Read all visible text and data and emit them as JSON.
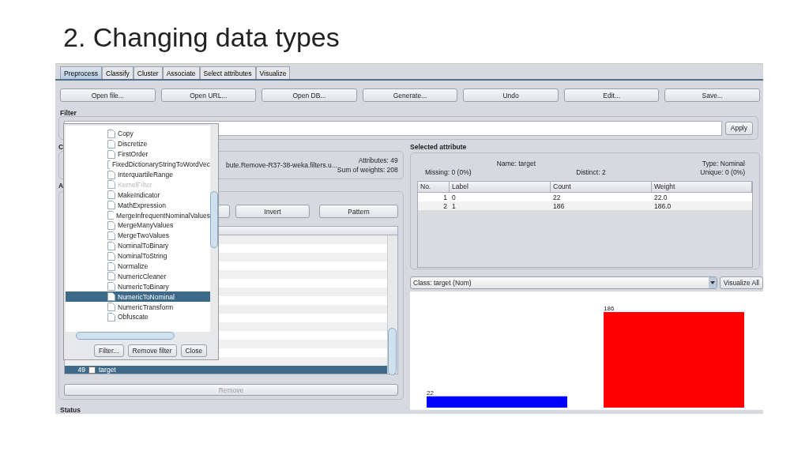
{
  "slide_title": "2. Changing data types",
  "tabs": [
    {
      "label": "Preprocess",
      "selected": true
    },
    {
      "label": "Classify",
      "selected": false
    },
    {
      "label": "Cluster",
      "selected": false
    },
    {
      "label": "Associate",
      "selected": false
    },
    {
      "label": "Select attributes",
      "selected": false
    },
    {
      "label": "Visualize",
      "selected": false
    }
  ],
  "toolbar": [
    "Open file...",
    "Open URL...",
    "Open DB...",
    "Generate...",
    "Undo",
    "Edit...",
    "Save..."
  ],
  "filter": {
    "label": "Filter",
    "apply": "Apply"
  },
  "current_relation": {
    "label": "C",
    "relation": "bute.Remove-R37-38-weka.filters.u...",
    "attributes": "Attributes: 49",
    "weights": "Sum of weights: 208"
  },
  "attributes": {
    "label": "A",
    "buttons": [
      "Invert",
      "Pattern"
    ],
    "rows": [
      {
        "no": "49",
        "name": "target",
        "checked": false,
        "selected": true
      }
    ],
    "remove": "Remove",
    "remove_disabled": true
  },
  "status_label": "Status",
  "selected_attribute": {
    "label": "Selected attribute",
    "name": "Name: target",
    "type": "Type: Nominal",
    "missing": "Missing: 0 (0%)",
    "distinct": "Distinct: 2",
    "unique": "Unique: 0 (0%)",
    "columns": [
      "No.",
      "Label",
      "Count",
      "Weight"
    ],
    "rows": [
      [
        "1",
        "0",
        "22",
        "22.0"
      ],
      [
        "2",
        "1",
        "186",
        "186.0"
      ]
    ]
  },
  "class_select": "Class: target (Nom)",
  "visualize_all": "Visualize All",
  "chart_data": {
    "type": "bar",
    "values": [
      22,
      186
    ],
    "colors": [
      "#0000ff",
      "#ff0000"
    ],
    "data_labels": true
  },
  "filter_popup": {
    "items": [
      {
        "label": "Copy",
        "disabled": false,
        "selected": false
      },
      {
        "label": "Discretize",
        "disabled": false,
        "selected": false
      },
      {
        "label": "FirstOrder",
        "disabled": false,
        "selected": false
      },
      {
        "label": "FixedDictionaryStringToWordVec",
        "disabled": false,
        "selected": false
      },
      {
        "label": "InterquartileRange",
        "disabled": false,
        "selected": false
      },
      {
        "label": "KernelFilter",
        "disabled": true,
        "selected": false
      },
      {
        "label": "MakeIndicator",
        "disabled": false,
        "selected": false
      },
      {
        "label": "MathExpression",
        "disabled": false,
        "selected": false
      },
      {
        "label": "MergeInfrequentNominalValues",
        "disabled": false,
        "selected": false
      },
      {
        "label": "MergeManyValues",
        "disabled": false,
        "selected": false
      },
      {
        "label": "MergeTwoValues",
        "disabled": false,
        "selected": false
      },
      {
        "label": "NominalToBinary",
        "disabled": false,
        "selected": false
      },
      {
        "label": "NominalToString",
        "disabled": false,
        "selected": false
      },
      {
        "label": "Normalize",
        "disabled": false,
        "selected": false
      },
      {
        "label": "NumericCleaner",
        "disabled": false,
        "selected": false
      },
      {
        "label": "NumericToBinary",
        "disabled": false,
        "selected": false
      },
      {
        "label": "NumericToNominal",
        "disabled": false,
        "selected": true
      },
      {
        "label": "NumericTransform",
        "disabled": false,
        "selected": false
      },
      {
        "label": "Obfuscate",
        "disabled": false,
        "selected": false
      }
    ],
    "buttons": [
      "Filter...",
      "Remove filter",
      "Close"
    ]
  }
}
